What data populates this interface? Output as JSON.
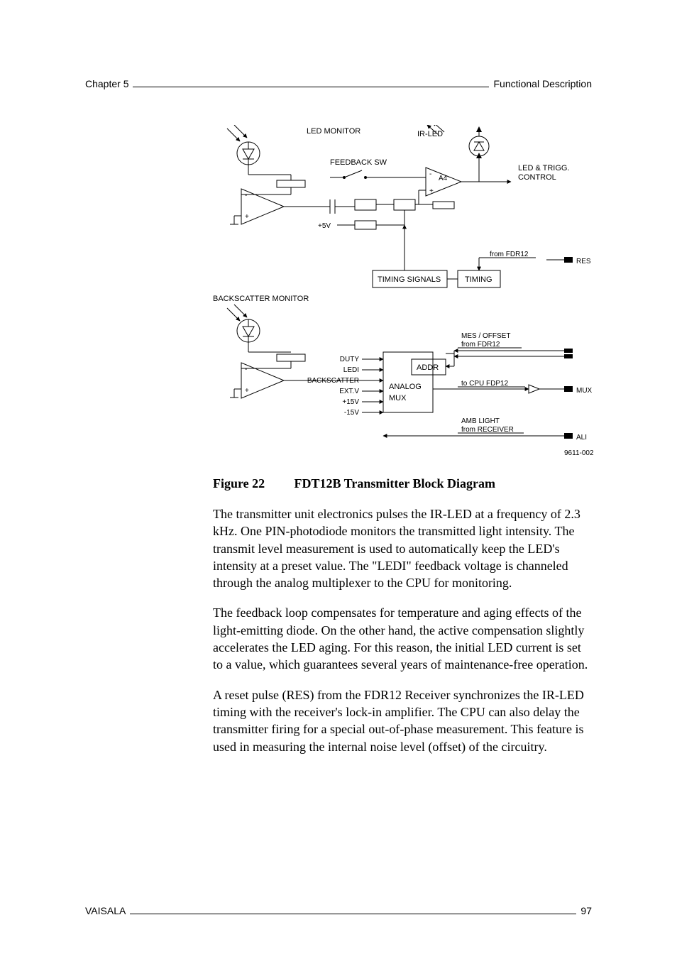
{
  "header": {
    "left": "Chapter 5",
    "right": "Functional Description"
  },
  "diagram": {
    "labels": {
      "led_monitor": "LED MONITOR",
      "ir_led": "IR-LED",
      "feedback_sw": "FEEDBACK SW",
      "a4_minus": "-",
      "a4_plus": "+",
      "a4": "A4",
      "led_trigg": "LED & TRIGG.\nCONTROL",
      "plus5v": "+5V",
      "from_fdr12": "from FDR12",
      "res": "RES",
      "timing_signals": "TIMING SIGNALS",
      "timing": "TIMING",
      "backscatter_monitor": "BACKSCATTER MONITOR",
      "mes_offset": "MES / OFFSET",
      "from_fdr12_2": "from FDR12",
      "duty": "DUTY",
      "ledi": "LEDI",
      "addr": "ADDR",
      "backscatter": "BACKSCATTER",
      "extv": "EXT.V",
      "plus15v": "+15V",
      "minus15v": "-15V",
      "analog": "ANALOG",
      "mux_label": "MUX",
      "to_cpu": "to CPU  FDP12",
      "mux": "MUX",
      "amb_light": "AMB LIGHT",
      "from_receiver": "from RECEIVER",
      "ali": "ALI",
      "drawing_no": "9611-002"
    }
  },
  "figure": {
    "number": "Figure 22",
    "title": "FDT12B Transmitter Block Diagram"
  },
  "paragraphs": [
    "The transmitter unit electronics pulses the IR-LED at a frequency of 2.3 kHz. One PIN-photodiode monitors the transmitted light intensity. The transmit level measurement is used to automatically keep the LED's intensity at a preset value. The \"LEDI\" feedback voltage is channeled through the analog multiplexer to the CPU for monitoring.",
    "The feedback loop compensates for temperature and aging effects of the light-emitting diode. On the other hand, the active compensation slightly accelerates the LED aging. For this reason, the initial LED current is set to a value, which guarantees several years of maintenance-free operation.",
    "A reset pulse (RES) from the FDR12 Receiver synchronizes the IR-LED timing with the receiver's lock-in amplifier. The CPU can also delay the transmitter firing for a special out-of-phase measurement. This feature is used in measuring the internal noise level (offset) of the circuitry."
  ],
  "footer": {
    "brand": "VAISALA",
    "page": "97"
  },
  "chart_data": {
    "type": "block-diagram",
    "title": "FDT12B Transmitter Block Diagram",
    "drawing_number": "9611-002",
    "blocks": [
      {
        "id": "led_monitor_diode",
        "label": "LED MONITOR",
        "kind": "photodiode"
      },
      {
        "id": "amp1",
        "label": "",
        "kind": "op-amp",
        "pins": [
          "-",
          "+"
        ]
      },
      {
        "id": "feedback_sw",
        "label": "FEEDBACK SW",
        "kind": "switch"
      },
      {
        "id": "ir_led",
        "label": "IR-LED",
        "kind": "led"
      },
      {
        "id": "a4",
        "label": "A4",
        "kind": "op-amp",
        "pins": [
          "-",
          "+"
        ]
      },
      {
        "id": "led_trigg_ctrl",
        "label": "LED & TRIGG. CONTROL",
        "kind": "text"
      },
      {
        "id": "cap",
        "label": "",
        "kind": "capacitor"
      },
      {
        "id": "plus5v",
        "label": "+5V",
        "kind": "rail"
      },
      {
        "id": "timing",
        "label": "TIMING",
        "kind": "block"
      },
      {
        "id": "timing_signals",
        "label": "TIMING SIGNALS",
        "kind": "block"
      },
      {
        "id": "backscatter_diode",
        "label": "BACKSCATTER MONITOR",
        "kind": "photodiode"
      },
      {
        "id": "amp2",
        "label": "",
        "kind": "op-amp",
        "pins": [
          "-",
          "+"
        ]
      },
      {
        "id": "analog_mux",
        "label": "ANALOG MUX",
        "kind": "block"
      },
      {
        "id": "addr",
        "label": "ADDR",
        "kind": "block"
      },
      {
        "id": "mux_pin",
        "label": "MUX",
        "kind": "connector"
      },
      {
        "id": "res_pin",
        "label": "RES",
        "kind": "connector"
      },
      {
        "id": "ali_pin",
        "label": "ALI",
        "kind": "connector"
      }
    ],
    "signals_into_analog_mux": [
      "DUTY",
      "LEDI",
      "BACKSCATTER",
      "EXT.V",
      "+15V",
      "-15V"
    ],
    "external_signals": [
      {
        "name": "RES",
        "from": "FDR12",
        "to": "TIMING"
      },
      {
        "name": "MES / OFFSET",
        "from": "FDR12",
        "to": "ADDR"
      },
      {
        "name": "to CPU FDP12",
        "from": "ANALOG MUX",
        "to": "MUX connector"
      },
      {
        "name": "AMB LIGHT",
        "from": "RECEIVER",
        "to": "ALI connector"
      }
    ]
  }
}
